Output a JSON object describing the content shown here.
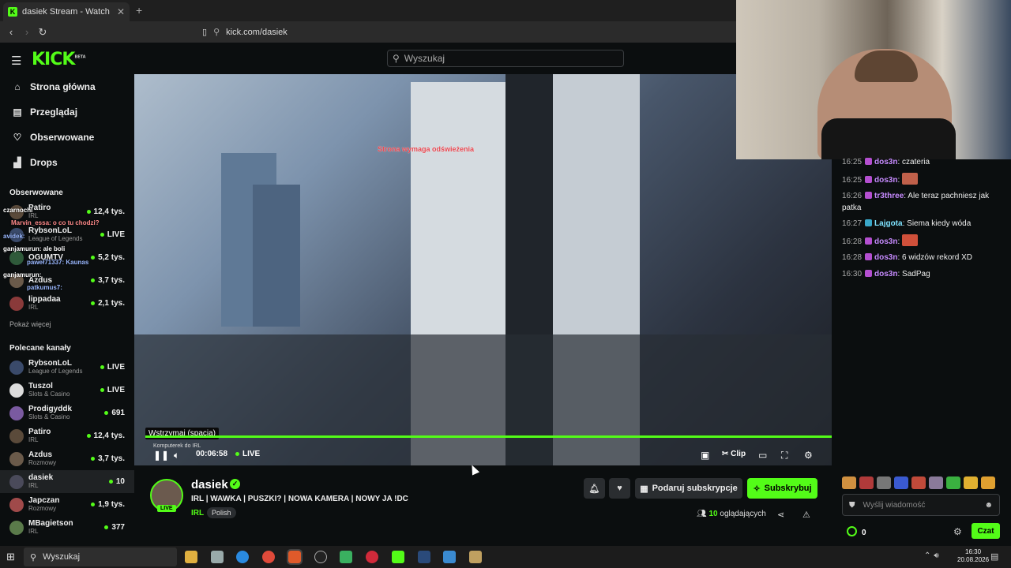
{
  "browser": {
    "tab_title": "dasiek Stream - Watch Live o",
    "tab_close": "✕",
    "new_tab": "+",
    "url": "kick.com/dasiek"
  },
  "header": {
    "logo": "KICK",
    "logo_badge": "BETA",
    "search_placeholder": "Wyszukaj"
  },
  "sidebar": {
    "nav": [
      {
        "label": "Strona główna",
        "icon": "home-icon"
      },
      {
        "label": "Przeglądaj",
        "icon": "browse-icon"
      },
      {
        "label": "Obserwowane",
        "icon": "heart-icon"
      },
      {
        "label": "Drops",
        "icon": "drops-icon"
      }
    ],
    "followed_title": "Obserwowane",
    "followed": [
      {
        "name": "Patiro",
        "category": "IRL",
        "viewers": "12,4 tys."
      },
      {
        "name": "RybsonLoL",
        "category": "League of Legends",
        "viewers": "LIVE"
      },
      {
        "name": "OGUMTV",
        "category": "",
        "viewers": "5,2 tys."
      },
      {
        "name": "Azdus",
        "category": "",
        "viewers": "3,7 tys."
      },
      {
        "name": "lippadaa",
        "category": "IRL",
        "viewers": "2,1 tys."
      }
    ],
    "show_more": "Pokaż więcej",
    "recommended_title": "Polecane kanały",
    "recommended": [
      {
        "name": "RybsonLoL",
        "category": "League of Legends",
        "viewers": "LIVE"
      },
      {
        "name": "Tuszol",
        "category": "Slots & Casino",
        "viewers": "LIVE"
      },
      {
        "name": "Prodigyddk",
        "category": "Slots & Casino",
        "viewers": "691"
      },
      {
        "name": "Patiro",
        "category": "IRL",
        "viewers": "12,4 tys."
      },
      {
        "name": "Azdus",
        "category": "Rozmowy",
        "viewers": "3,7 tys."
      },
      {
        "name": "dasiek",
        "category": "IRL",
        "viewers": "10"
      },
      {
        "name": "Japczan",
        "category": "Rozmowy",
        "viewers": "1,9 tys."
      },
      {
        "name": "MBagietson",
        "category": "IRL",
        "viewers": "377"
      }
    ]
  },
  "overlay_chat": [
    {
      "text": "czarnochl"
    },
    {
      "text": "Marvin_essa: o co tu chodzi?"
    },
    {
      "text": "avidek:"
    },
    {
      "text": "ganjamurun: ale boli"
    },
    {
      "text": "paweł71337: Kaunas"
    },
    {
      "text": "ganjamurun:"
    },
    {
      "text": "patkumus7:"
    }
  ],
  "player": {
    "refresh_notice": "Strona wymaga odświeżenia",
    "tooltip": "Wstrzymaj (spacja)",
    "small_label": "Komputerek do IRL",
    "time": "00:06:58",
    "live": "LIVE",
    "clip": "Clip"
  },
  "channel": {
    "name": "dasiek",
    "live_badge": "LIVE",
    "title": "IRL | WAWKA | PUSZKI? | NOWA KAMERA | NOWY JA !DC",
    "category": "IRL",
    "language": "Polish",
    "gift_label": "Podaruj subskrypcje",
    "subscribe_label": "Subskrybuj",
    "viewers_count": "10",
    "viewers_label": "oglądających"
  },
  "chat": {
    "messages": [
      {
        "time": "16:25",
        "user": "dos3n",
        "text": "czateria",
        "color": "#c78bff"
      },
      {
        "time": "16:25",
        "user": "dos3n",
        "text": "",
        "emote": true,
        "color": "#c78bff"
      },
      {
        "time": "16:26",
        "user": "tr3three",
        "text": "Ale teraz pachniesz jak patka",
        "color": "#c78bff"
      },
      {
        "time": "16:27",
        "user": "Lajgota",
        "text": "Siema kiedy wóda",
        "color": "#7fe3ff"
      },
      {
        "time": "16:28",
        "user": "dos3n",
        "text": "",
        "emote": true,
        "color": "#c78bff"
      },
      {
        "time": "16:28",
        "user": "dos3n",
        "text": "6 widzów rekord XD",
        "color": "#c78bff"
      },
      {
        "time": "16:30",
        "user": "dos3n",
        "text": "SadPag",
        "color": "#c78bff"
      }
    ],
    "input_placeholder": "Wyślij wiadomość",
    "points": "0",
    "send_label": "Czat"
  },
  "taskbar": {
    "search": "Wyszukaj",
    "time": "16:30",
    "date": "20.08.2026"
  }
}
